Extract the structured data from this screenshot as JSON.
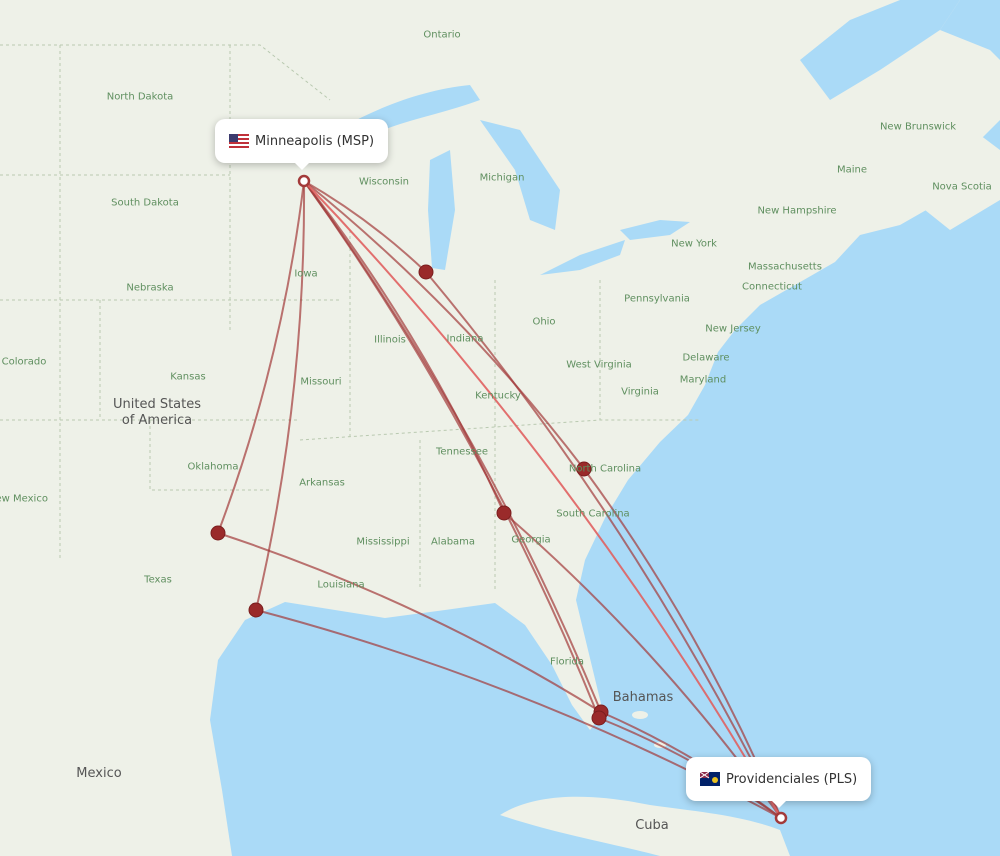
{
  "origin": {
    "name": "Minneapolis (MSP)",
    "flag": "us-flag"
  },
  "destination": {
    "name": "Providenciales (PLS)",
    "flag": "tc-flag"
  },
  "route_color": "#a33a3a",
  "labels": {
    "ontario": "Ontario",
    "north_dakota": "North Dakota",
    "south_dakota": "South Dakota",
    "nebraska": "Nebraska",
    "colorado": "Colorado",
    "kansas": "Kansas",
    "oklahoma": "Oklahoma",
    "new_mexico": "New Mexico",
    "texas": "Texas",
    "wisconsin": "Wisconsin",
    "michigan": "Michigan",
    "iowa": "Iowa",
    "illinois": "Illinois",
    "indiana": "Indiana",
    "ohio": "Ohio",
    "missouri": "Missouri",
    "kentucky": "Kentucky",
    "tennessee": "Tennessee",
    "arkansas": "Arkansas",
    "mississippi": "Mississippi",
    "alabama": "Alabama",
    "georgia": "Georgia",
    "louisiana": "Louisiana",
    "florida": "Florida",
    "south_carolina": "South Carolina",
    "north_carolina": "North Carolina",
    "virginia": "Virginia",
    "west_virginia": "West Virginia",
    "pennsylvania": "Pennsylvania",
    "new_york": "New York",
    "new_jersey": "New Jersey",
    "delaware": "Delaware",
    "maryland": "Maryland",
    "connecticut": "Connecticut",
    "massachusetts": "Massachusetts",
    "new_hampshire": "New Hampshire",
    "maine": "Maine",
    "new_brunswick": "New Brunswick",
    "nova_scotia": "Nova Scotia",
    "usa": "United States of America",
    "mexico": "Mexico",
    "cuba": "Cuba",
    "bahamas": "Bahamas"
  }
}
